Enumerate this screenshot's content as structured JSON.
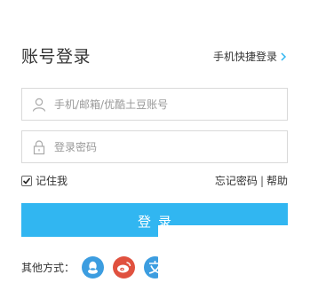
{
  "header": {
    "title": "账号登录",
    "switch_label": "手机快捷登录"
  },
  "form": {
    "username_placeholder": "手机/邮箱/优酷土豆账号",
    "password_placeholder": "登录密码",
    "remember_label": "记住我",
    "remember_checked": true,
    "forgot_label": "忘记密码",
    "separator": "|",
    "help_label": "帮助",
    "submit_label": "登录"
  },
  "social": {
    "label": "其他方式：",
    "providers": [
      {
        "name": "qq-icon",
        "color": "#3c9de0"
      },
      {
        "name": "weibo-icon",
        "color": "#e0513f"
      },
      {
        "name": "alipay-icon",
        "color": "#3c9de0"
      }
    ]
  },
  "colors": {
    "accent": "#31b6f1",
    "border": "#d9d9d9",
    "chevron": "#31b6f1"
  }
}
